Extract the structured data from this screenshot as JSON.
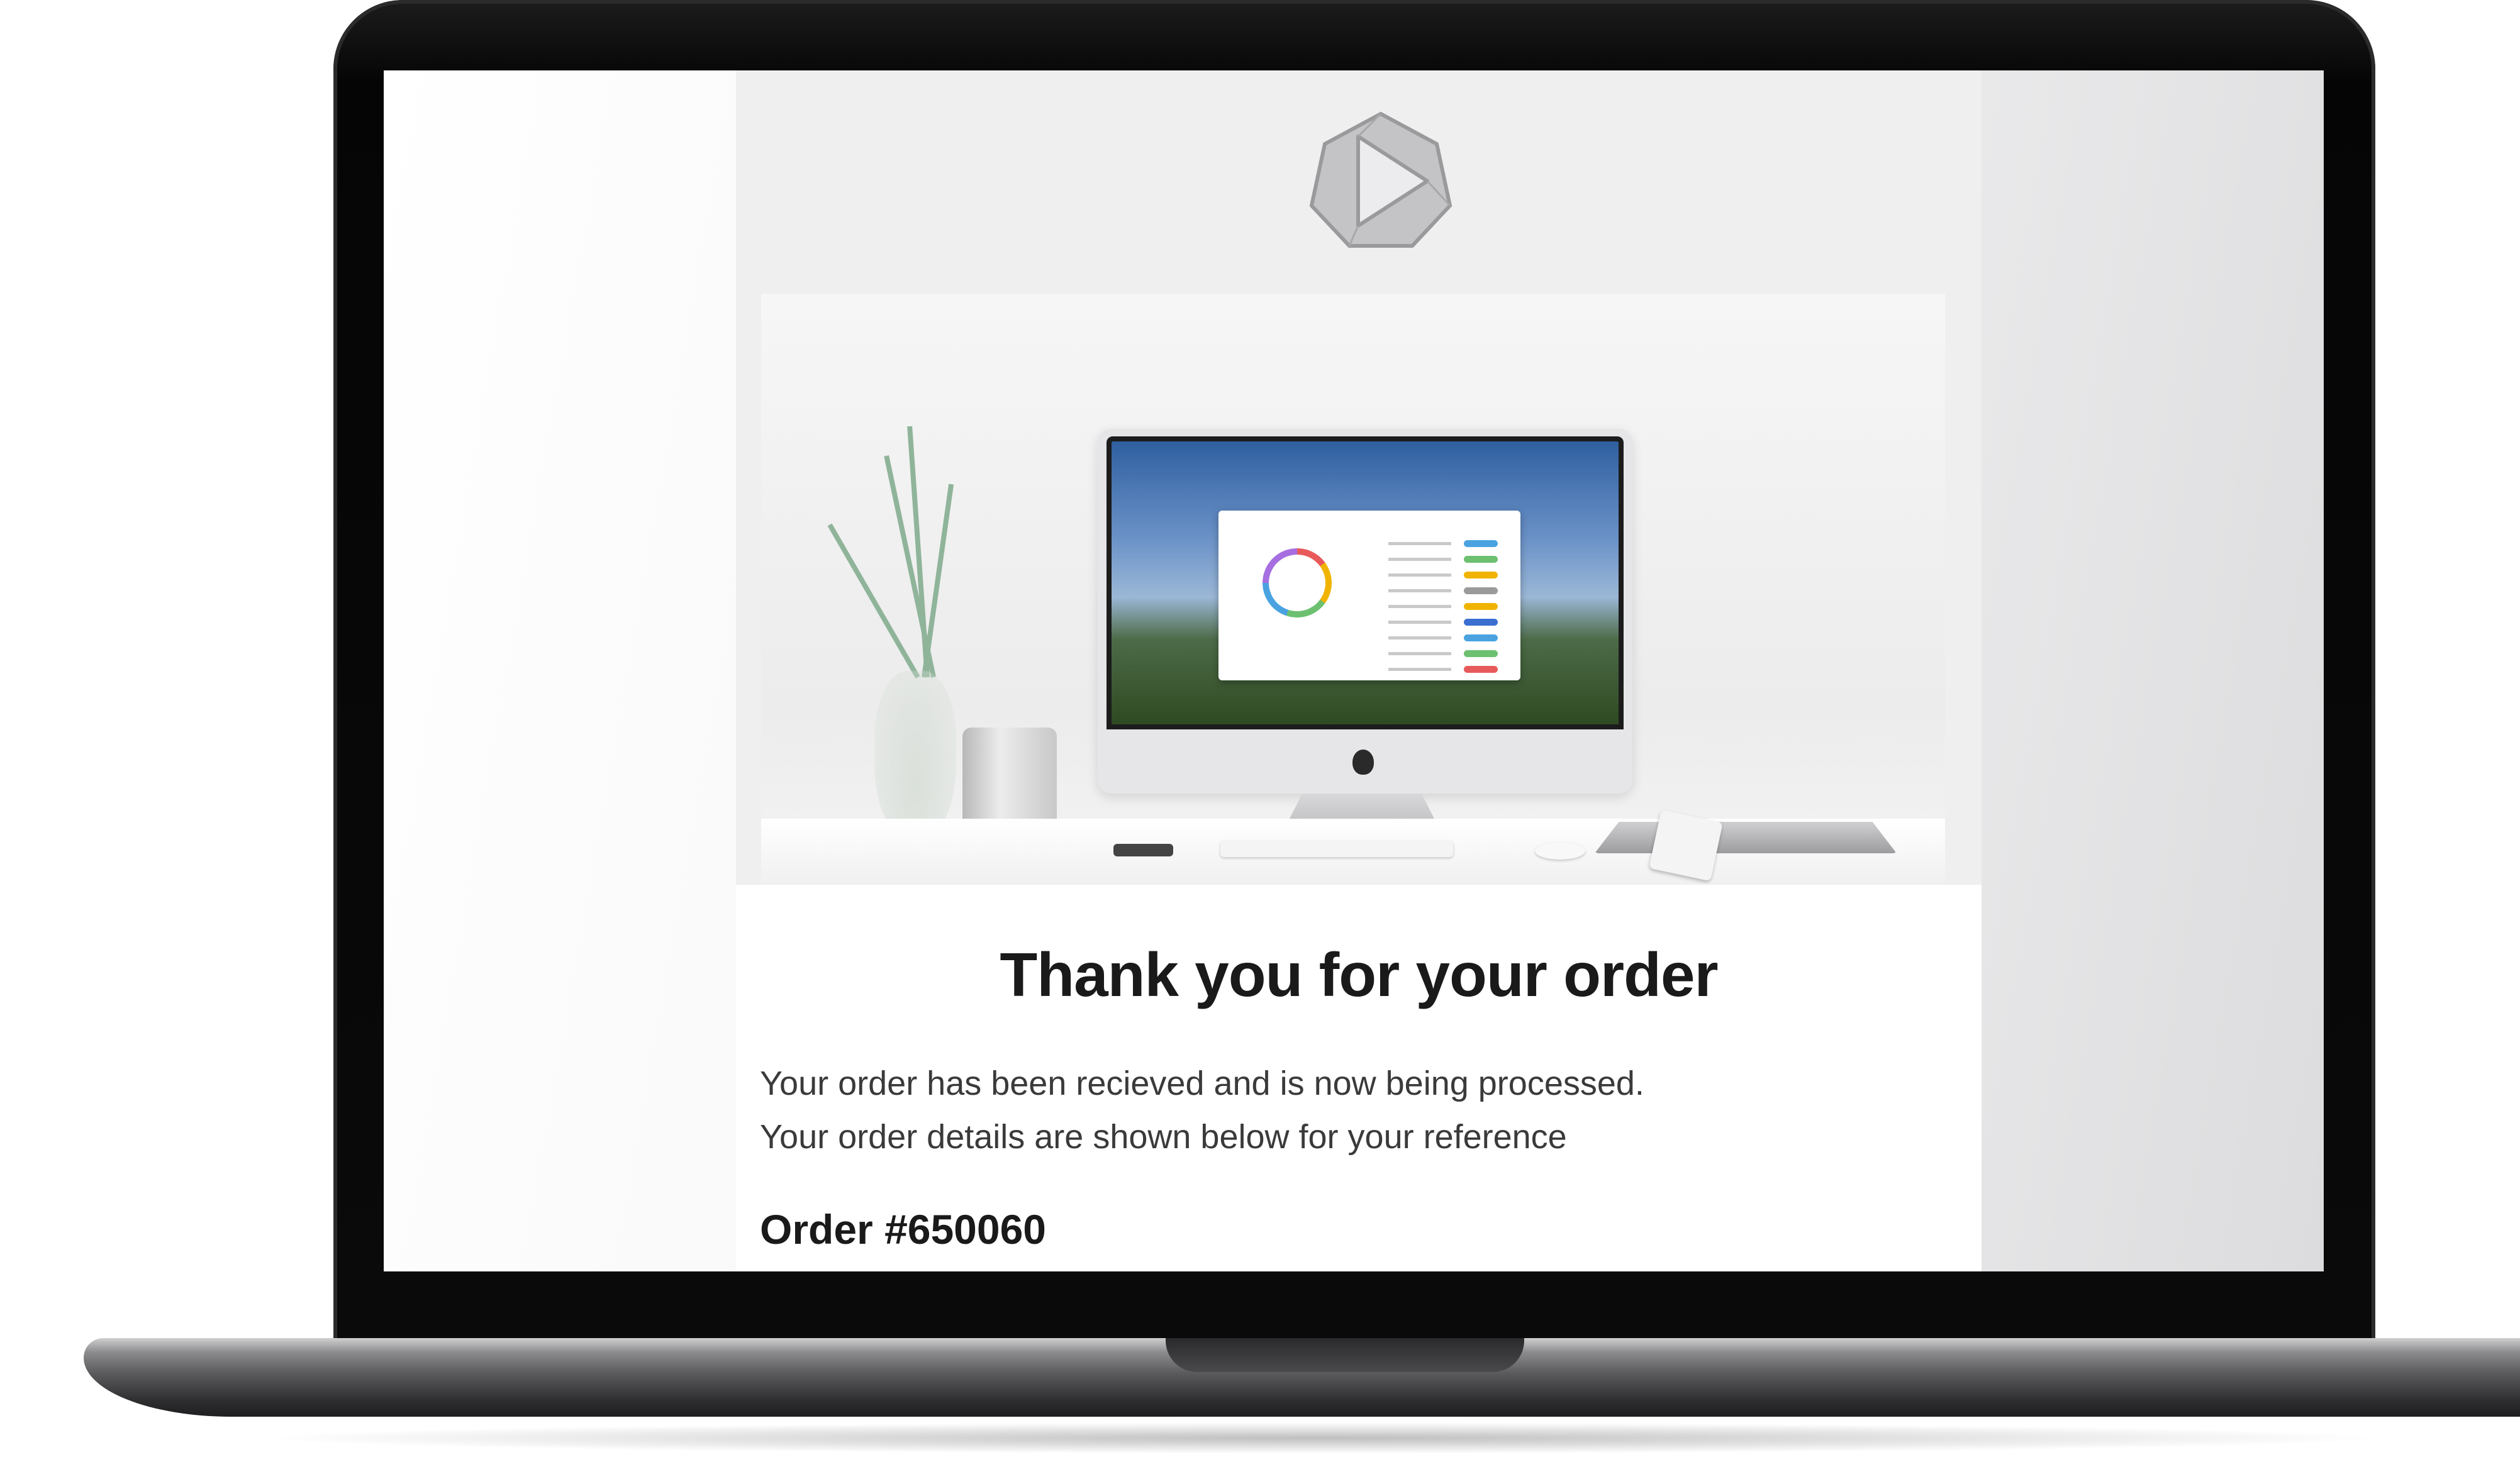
{
  "email": {
    "title": "Thank you for your order",
    "message_line1": "Your order has been recieved and is now being processed.",
    "message_line2": "Your order details are shown below for your reference",
    "order_label": "Order #650060"
  },
  "colors": {
    "heading": "#1a1a1a",
    "body_text": "#3a3a3a",
    "email_background": "#efefef",
    "content_background": "#ffffff",
    "laptop_bezel": "#0a0a0a"
  },
  "icons": {
    "logo": "hexagon-play-logo-icon"
  }
}
